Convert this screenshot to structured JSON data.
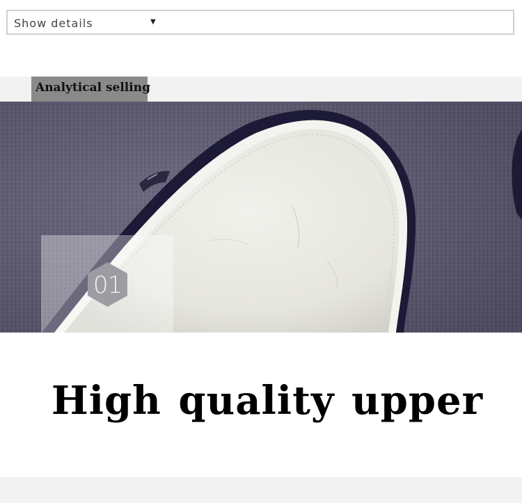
{
  "details_select": {
    "label": "Show details",
    "caret_icon": "caret-down-icon"
  },
  "section": {
    "title": "Analytical selling"
  },
  "photo": {
    "subject": "shoe-toe-photo"
  },
  "feature": {
    "number": "01",
    "headline": "High quality upper"
  },
  "colors": {
    "tab_background": "#8a8a8a",
    "band_background": "#f2f2f2",
    "fabric": "#5c5a6e",
    "rubber_sole": "#1c1a36",
    "leather": "#e8e8e2",
    "badge_fill": "#9c9ca2"
  }
}
